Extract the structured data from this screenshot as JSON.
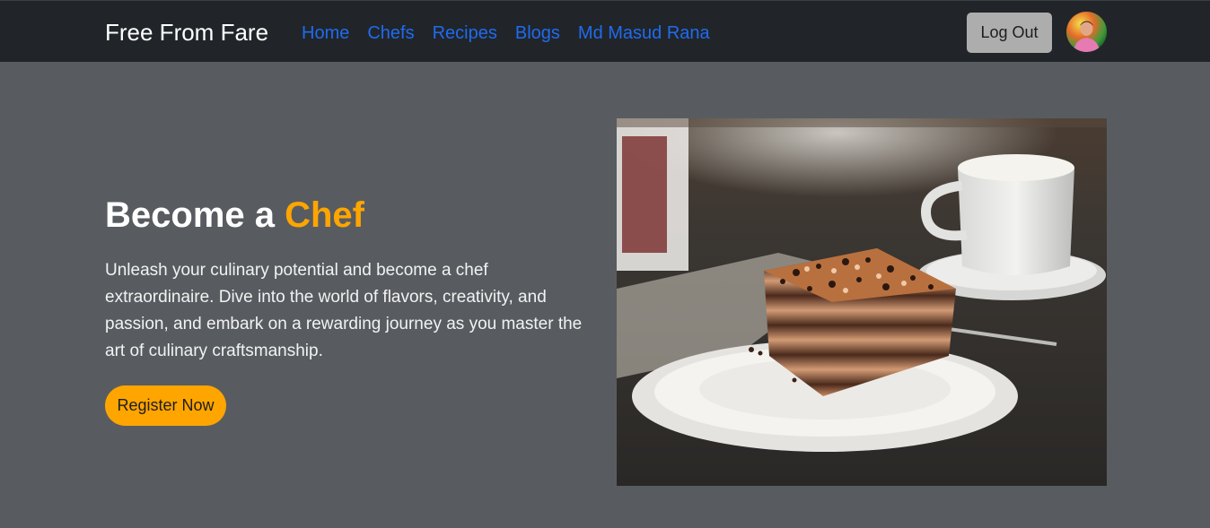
{
  "header": {
    "brand": "Free From Fare",
    "nav": [
      "Home",
      "Chefs",
      "Recipes",
      "Blogs",
      "Md Masud Rana"
    ],
    "logout_label": "Log Out",
    "avatar_icon": "user-avatar-photo"
  },
  "hero": {
    "title_prefix": "Become a ",
    "title_accent": "Chef",
    "description": "Unleash your culinary potential and become a chef extraordinaire. Dive into the world of flavors, creativity, and passion, and embark on a rewarding journey as you master the art of culinary craftsmanship.",
    "cta_label": "Register Now",
    "image": "cake-and-coffee-photo"
  },
  "colors": {
    "navbar_bg": "#212529",
    "page_bg": "#585c60",
    "accent": "#ffa500",
    "link": "#1f6bf0",
    "logout_bg": "#adadad"
  }
}
